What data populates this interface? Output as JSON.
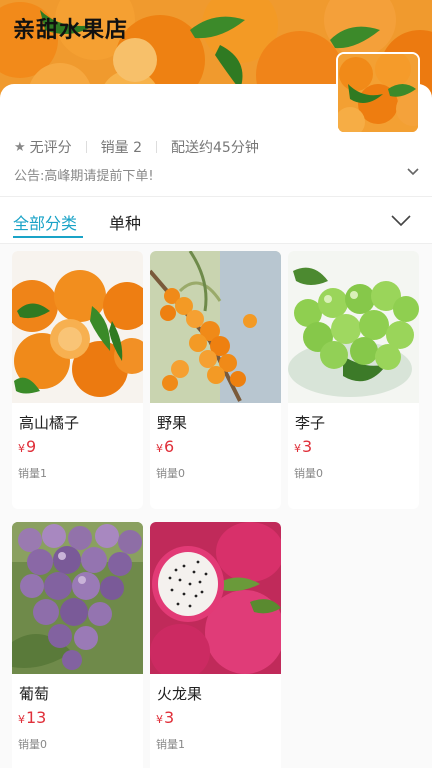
{
  "shop": {
    "name": "亲甜水果店",
    "rating": "无评分",
    "sales": "销量 2",
    "delivery": "配送约45分钟",
    "notice": "公告:高峰期请提前下单!"
  },
  "tabs": [
    {
      "label": "全部分类",
      "active": true
    },
    {
      "label": "单种",
      "active": false
    }
  ],
  "currency": "¥",
  "products": [
    {
      "name": "高山橘子",
      "price": "9",
      "sales": "销量1",
      "image": "mandarins"
    },
    {
      "name": "野果",
      "price": "6",
      "sales": "销量0",
      "image": "sea-buckthorn"
    },
    {
      "name": "李子",
      "price": "3",
      "sales": "销量0",
      "image": "green-plums"
    },
    {
      "name": "葡萄",
      "price": "13",
      "sales": "销量0",
      "image": "grapes"
    },
    {
      "name": "火龙果",
      "price": "3",
      "sales": "销量1",
      "image": "dragon-fruit"
    }
  ],
  "colors": {
    "accent": "#1aa3c7",
    "price": "#e0303a"
  }
}
